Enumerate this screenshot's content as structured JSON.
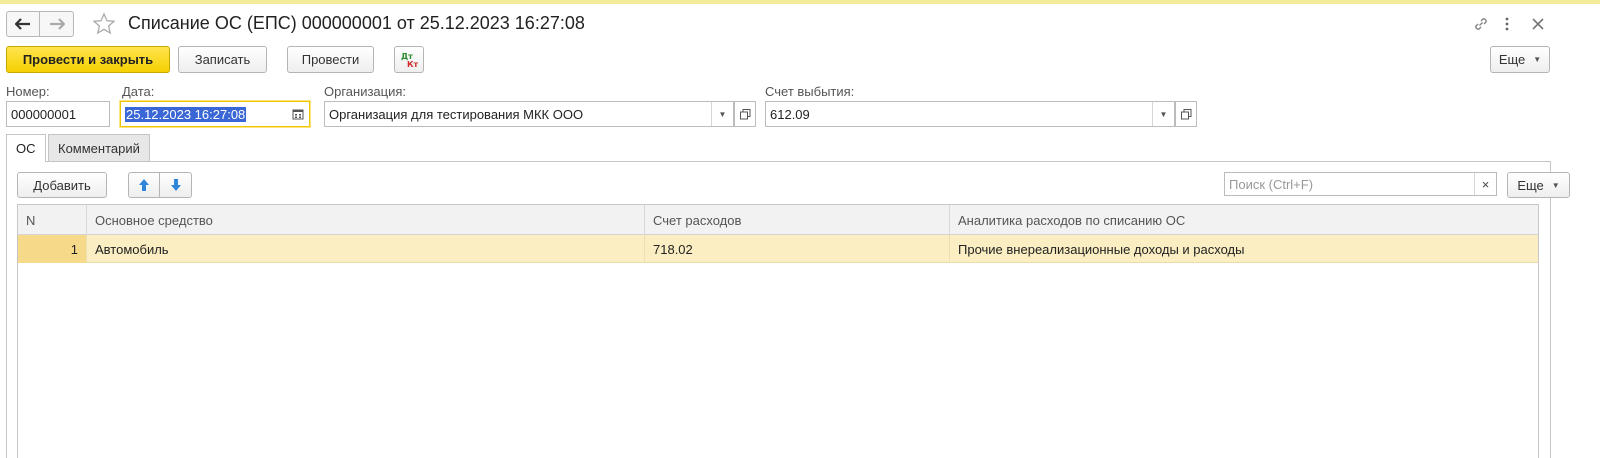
{
  "window": {
    "title": "Списание ОС (ЕПС) 000000001 от 25.12.2023 16:27:08"
  },
  "toolbar": {
    "post_and_close": "Провести и закрыть",
    "save": "Записать",
    "post": "Провести",
    "more": "Еще"
  },
  "icons": {
    "back": "arrow-left-icon",
    "forward": "arrow-right-icon",
    "favorite": "star-icon",
    "link": "link-icon",
    "menu": "kebab-menu-icon",
    "close": "close-icon",
    "dtkt": "dt-kt-icon",
    "calendar": "calendar-icon",
    "dropdown": "chevron-down-icon",
    "open": "open-window-icon",
    "up": "arrow-up-icon",
    "down": "arrow-down-icon"
  },
  "icon_text": {
    "dt": "Дт",
    "kt": "Кт"
  },
  "fields": {
    "number_label": "Номер:",
    "number_value": "000000001",
    "date_label": "Дата:",
    "date_value": "25.12.2023 16:27:08",
    "org_label": "Организация:",
    "org_value": "Организация для тестирования МКК ООО",
    "account_label": "Счет выбытия:",
    "account_value": "612.09"
  },
  "tabs": [
    {
      "label": "ОС",
      "active": true
    },
    {
      "label": "Комментарий",
      "active": false
    }
  ],
  "table_toolbar": {
    "add": "Добавить",
    "search_placeholder": "Поиск (Ctrl+F)",
    "clear": "×",
    "more": "Еще"
  },
  "table": {
    "columns": [
      "N",
      "Основное средство",
      "Счет расходов",
      "Аналитика расходов по списанию ОС"
    ],
    "rows": [
      [
        "1",
        "Автомобиль",
        "718.02",
        "Прочие внереализационные доходы и расходы"
      ]
    ]
  },
  "colors": {
    "primary_button": "#f5d000",
    "selected_row": "#fbeec2",
    "focus_border": "#f0c400",
    "text_selection": "#3b67d6",
    "up_down_arrows": "#2f86d8",
    "dtkt_green": "#2e8b2e",
    "dtkt_red": "#d22b2b"
  }
}
